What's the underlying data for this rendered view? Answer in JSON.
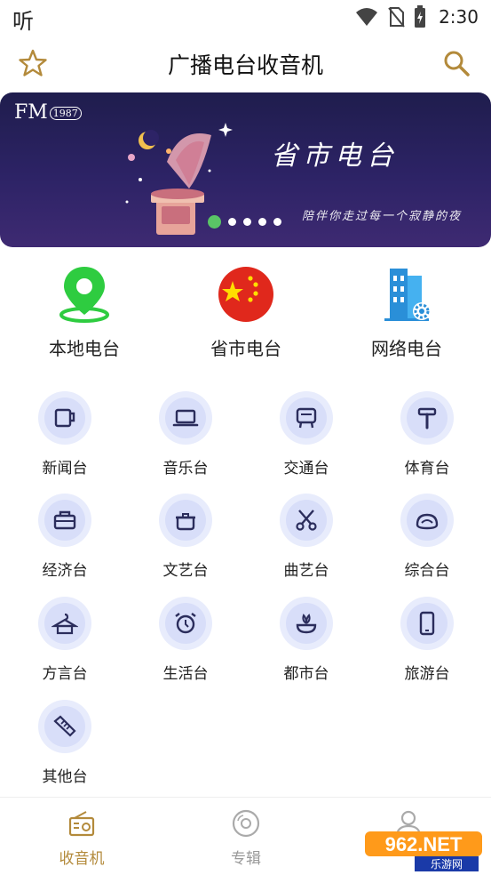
{
  "status_bar": {
    "carrier": "听",
    "time": "2:30"
  },
  "header": {
    "title": "广播电台收音机"
  },
  "banner": {
    "fm_label": "FM",
    "fm_year": "1987",
    "title": "省市电台",
    "subtitle": "陪伴你走过每一个寂静的夜",
    "page_count": 5,
    "active_index": 0
  },
  "top_categories": [
    {
      "label": "本地电台",
      "icon": "location-pin-icon"
    },
    {
      "label": "省市电台",
      "icon": "china-flag-icon"
    },
    {
      "label": "网络电台",
      "icon": "building-gear-icon"
    }
  ],
  "categories": [
    {
      "label": "新闻台",
      "icon": "cup-icon"
    },
    {
      "label": "音乐台",
      "icon": "laptop-icon"
    },
    {
      "label": "交通台",
      "icon": "appliance-icon"
    },
    {
      "label": "体育台",
      "icon": "hammer-icon"
    },
    {
      "label": "经济台",
      "icon": "toolbox-icon"
    },
    {
      "label": "文艺台",
      "icon": "pot-icon"
    },
    {
      "label": "曲艺台",
      "icon": "scissors-icon"
    },
    {
      "label": "综合台",
      "icon": "cushion-icon"
    },
    {
      "label": "方言台",
      "icon": "hanger-icon"
    },
    {
      "label": "生活台",
      "icon": "alarm-clock-icon"
    },
    {
      "label": "都市台",
      "icon": "plant-icon"
    },
    {
      "label": "旅游台",
      "icon": "phone-icon"
    },
    {
      "label": "其他台",
      "icon": "comb-icon"
    }
  ],
  "bottom_nav": [
    {
      "label": "收音机",
      "icon": "radio-icon",
      "active": true
    },
    {
      "label": "专辑",
      "icon": "disc-icon",
      "active": false
    },
    {
      "label": "",
      "icon": "person-icon",
      "active": false
    }
  ],
  "watermark": {
    "text": "962.NET",
    "subtext": "乐游网"
  },
  "colors": {
    "accent": "#b38a3b",
    "banner_dark": "#2d2366",
    "dot_active": "#5ac466",
    "circle_bg": "#e8ecfc"
  }
}
